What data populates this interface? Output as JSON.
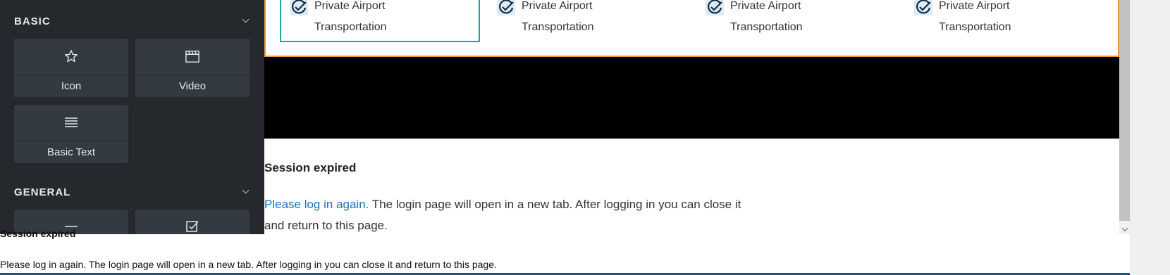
{
  "sidebar": {
    "basic": {
      "title": "BASIC",
      "widgets": [
        {
          "label": "Icon",
          "icon": "star-icon"
        },
        {
          "label": "Video",
          "icon": "video-clapper-icon"
        },
        {
          "label": "Basic Text",
          "icon": "text-lines-icon"
        }
      ]
    },
    "general": {
      "title": "GENERAL",
      "widgets": [
        {
          "label": "",
          "icon": "divider-icon"
        },
        {
          "label": "",
          "icon": "checkbox-icon"
        }
      ]
    }
  },
  "features": [
    {
      "line1": "Private Airport",
      "line2": "Transportation"
    },
    {
      "line1": "Private Airport",
      "line2": "Transportation"
    },
    {
      "line1": "Private Airport",
      "line2": "Transportation"
    },
    {
      "line1": "Private Airport",
      "line2": "Transportation"
    }
  ],
  "session": {
    "title": "Session expired",
    "link": "Please log in again.",
    "text_line1": " The login page will open in a new tab. After logging in you can close it",
    "text_line2": "and return to this page."
  },
  "underlying": {
    "title": "Session expired",
    "text": "Please log in again. The login page will open in a new tab. After logging in you can close it and return to this page."
  },
  "colors": {
    "sidebar_bg": "#25292e",
    "widget_bg": "#343a41",
    "accent_orange": "#e89a3c",
    "accent_teal": "#1fa39a",
    "link_blue": "#1e73be"
  }
}
